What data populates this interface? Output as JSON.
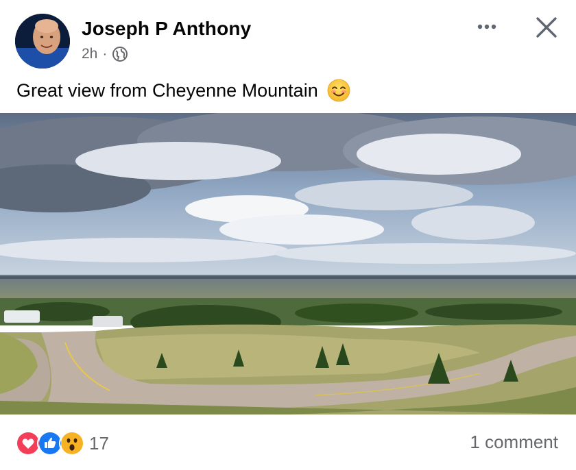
{
  "post": {
    "author": "Joseph P Anthony",
    "time": "2h",
    "separator": "·",
    "audience_icon": "globe-icon",
    "text": "Great view from Cheyenne Mountain",
    "emoji": "smiling-face-icon"
  },
  "header_actions": {
    "more_icon": "ellipsis-icon",
    "close_icon": "close-icon"
  },
  "photo": {
    "subject": "Panoramic view from Cheyenne Mountain with winding road, campers, trees, distant city and cloudy sky"
  },
  "footer": {
    "reaction_icons": [
      "love-reaction-icon",
      "like-reaction-icon",
      "wow-reaction-icon"
    ],
    "reaction_count": "17",
    "comment_count": "1 comment"
  },
  "colors": {
    "text_primary": "#050505",
    "text_secondary": "#65676b",
    "love": "#f33e58",
    "like": "#1877f2",
    "wow": "#f7b125"
  }
}
